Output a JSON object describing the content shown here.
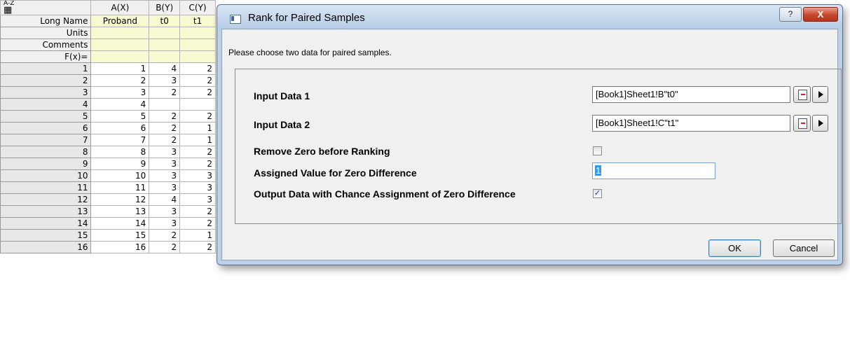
{
  "worksheet": {
    "corner_icon_text": "A-Z",
    "columns": [
      "A(X)",
      "B(Y)",
      "C(Y)"
    ],
    "meta_rows": [
      {
        "label": "Long Name",
        "values": [
          "Proband",
          "t0",
          "t1"
        ]
      },
      {
        "label": "Units",
        "values": [
          "",
          "",
          ""
        ]
      },
      {
        "label": "Comments",
        "values": [
          "",
          "",
          ""
        ]
      },
      {
        "label": "F(x)=",
        "values": [
          "",
          "",
          ""
        ]
      }
    ],
    "data_rows": [
      {
        "row": "1",
        "values": [
          "1",
          "4",
          "2"
        ]
      },
      {
        "row": "2",
        "values": [
          "2",
          "3",
          "2"
        ]
      },
      {
        "row": "3",
        "values": [
          "3",
          "2",
          "2"
        ]
      },
      {
        "row": "4",
        "values": [
          "4",
          "",
          ""
        ]
      },
      {
        "row": "5",
        "values": [
          "5",
          "2",
          "2"
        ]
      },
      {
        "row": "6",
        "values": [
          "6",
          "2",
          "1"
        ]
      },
      {
        "row": "7",
        "values": [
          "7",
          "2",
          "1"
        ]
      },
      {
        "row": "8",
        "values": [
          "8",
          "3",
          "2"
        ]
      },
      {
        "row": "9",
        "values": [
          "9",
          "3",
          "2"
        ]
      },
      {
        "row": "10",
        "values": [
          "10",
          "3",
          "3"
        ]
      },
      {
        "row": "11",
        "values": [
          "11",
          "3",
          "3"
        ]
      },
      {
        "row": "12",
        "values": [
          "12",
          "4",
          "3"
        ]
      },
      {
        "row": "13",
        "values": [
          "13",
          "3",
          "2"
        ]
      },
      {
        "row": "14",
        "values": [
          "14",
          "3",
          "2"
        ]
      },
      {
        "row": "15",
        "values": [
          "15",
          "2",
          "1"
        ]
      },
      {
        "row": "16",
        "values": [
          "16",
          "2",
          "2"
        ]
      }
    ]
  },
  "dialog": {
    "title": "Rank for Paired Samples",
    "help_label": "?",
    "close_label": "X",
    "instruction": "Please choose two data for paired samples.",
    "input1": {
      "label": "Input Data 1",
      "value": "[Book1]Sheet1!B\"t0\""
    },
    "input2": {
      "label": "Input Data 2",
      "value": "[Book1]Sheet1!C\"t1\""
    },
    "remove_zero": {
      "label": "Remove Zero before Ranking",
      "checked": false
    },
    "zero_value": {
      "label": "Assigned Value for Zero Difference",
      "value": "1"
    },
    "chance_output": {
      "label": "Output Data with Chance Assignment of Zero Difference",
      "checked": true,
      "mark": "✓"
    },
    "ok_label": "OK",
    "cancel_label": "Cancel"
  }
}
